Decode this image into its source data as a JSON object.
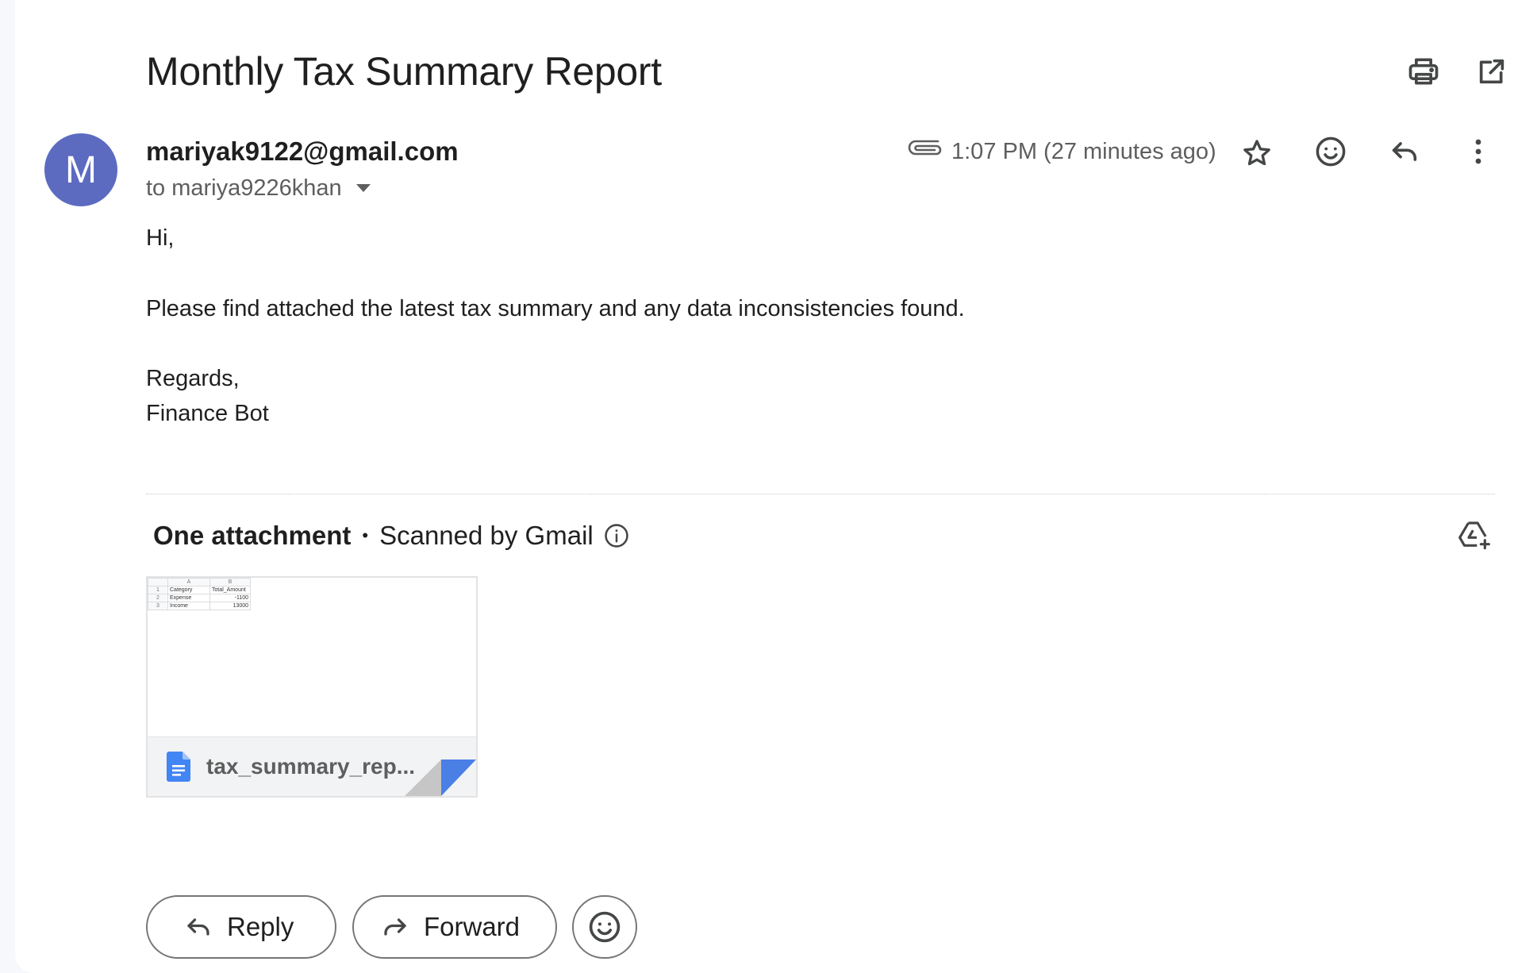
{
  "email": {
    "subject": "Monthly Tax Summary Report",
    "sender": {
      "avatar_letter": "M",
      "avatar_color": "#5c6bc0",
      "email": "mariyak9122@gmail.com"
    },
    "recipient_line": "to mariya9226khan",
    "timestamp": "1:07 PM (27 minutes ago)",
    "body": {
      "greeting": "Hi,",
      "message": "Please find attached the latest tax summary and any data inconsistencies found.",
      "closing": "Regards,",
      "signature": "Finance Bot"
    }
  },
  "toolbar": {
    "top_icons": [
      "print-icon",
      "open-in-new-window-icon"
    ],
    "message_icons": [
      "attachment-clip-icon",
      "star-icon",
      "emoji-reaction-icon",
      "reply-icon",
      "more-options-icon"
    ]
  },
  "attachments": {
    "count_label": "One attachment",
    "scanned_label": "Scanned by Gmail",
    "add_to_drive_icon": "add-to-drive-icon",
    "items": [
      {
        "file_name": "tax_summary_rep...",
        "file_icon": "google-docs-icon",
        "preview": {
          "columns": [
            "A",
            "B"
          ],
          "rows": [
            {
              "n": "1",
              "a": "Category",
              "b": "Total_Amount"
            },
            {
              "n": "2",
              "a": "Expense",
              "b": "-1100"
            },
            {
              "n": "3",
              "a": "Income",
              "b": "13000"
            }
          ]
        }
      }
    ]
  },
  "actions": {
    "reply_label": "Reply",
    "forward_label": "Forward",
    "emoji_icon": "add-reaction-icon"
  },
  "colors": {
    "accent_blue": "#4285f4",
    "text_primary": "#1f1f1f",
    "text_secondary": "#5e5e5e"
  }
}
